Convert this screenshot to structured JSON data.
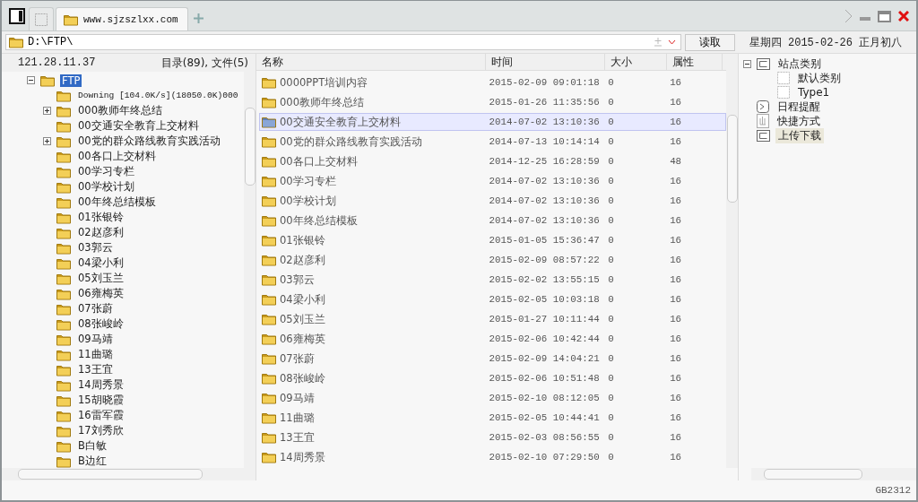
{
  "tabs": [
    {
      "label": "www.sjzszlxx.com",
      "selected": true
    }
  ],
  "address": {
    "value": "D:\\FTP\\",
    "read_button": "读取"
  },
  "date": "星期四 2015-02-26 正月初八",
  "left_header": {
    "ip": "121.28.11.37",
    "counts": "目录(89), 文件(5)"
  },
  "folder_tree": [
    {
      "label": "FTP",
      "selected": true,
      "expanded": true,
      "children": [
        {
          "label": "Downing [104.0K/s](18050.0K)000",
          "kind": "status"
        },
        {
          "label": "000教师年终总结",
          "kind": "folder",
          "expanded": false
        },
        {
          "label": "00交通安全教育上交材料",
          "kind": "folder"
        },
        {
          "label": "00党的群众路线教育实践活动",
          "kind": "folder",
          "expanded": false
        },
        {
          "label": "00各口上交材料",
          "kind": "folder"
        },
        {
          "label": "00学习专栏",
          "kind": "folder"
        },
        {
          "label": "00学校计划",
          "kind": "folder"
        },
        {
          "label": "00年终总结模板",
          "kind": "folder"
        },
        {
          "label": "01张银铃",
          "kind": "folder"
        },
        {
          "label": "02赵彦利",
          "kind": "folder"
        },
        {
          "label": "03郭云",
          "kind": "folder"
        },
        {
          "label": "04梁小利",
          "kind": "folder"
        },
        {
          "label": "05刘玉兰",
          "kind": "folder"
        },
        {
          "label": "06雍梅英",
          "kind": "folder"
        },
        {
          "label": "07张蔚",
          "kind": "folder"
        },
        {
          "label": "08张峻岭",
          "kind": "folder"
        },
        {
          "label": "09马靖",
          "kind": "folder"
        },
        {
          "label": "11曲璐",
          "kind": "folder"
        },
        {
          "label": "13王宜",
          "kind": "folder"
        },
        {
          "label": "14周秀景",
          "kind": "folder"
        },
        {
          "label": "15胡晓霞",
          "kind": "folder"
        },
        {
          "label": "16雷军霞",
          "kind": "folder"
        },
        {
          "label": "17刘秀欣",
          "kind": "folder"
        },
        {
          "label": "B白敏",
          "kind": "folder"
        },
        {
          "label": "B边红",
          "kind": "folder"
        }
      ]
    }
  ],
  "table": {
    "columns": [
      "名称",
      "时间",
      "大小",
      "属性"
    ],
    "rows": [
      {
        "name": "0000PPT培训内容",
        "time": "2015-02-09 09:01:18",
        "size": "0",
        "attr": "16",
        "selected": false
      },
      {
        "name": "000教师年终总结",
        "time": "2015-01-26 11:35:56",
        "size": "0",
        "attr": "16",
        "selected": false
      },
      {
        "name": "00交通安全教育上交材料",
        "time": "2014-07-02 13:10:36",
        "size": "0",
        "attr": "16",
        "selected": true
      },
      {
        "name": "00党的群众路线教育实践活动",
        "time": "2014-07-13 10:14:14",
        "size": "0",
        "attr": "16",
        "selected": false
      },
      {
        "name": "00各口上交材料",
        "time": "2014-12-25 16:28:59",
        "size": "0",
        "attr": "48",
        "selected": false
      },
      {
        "name": "00学习专栏",
        "time": "2014-07-02 13:10:36",
        "size": "0",
        "attr": "16",
        "selected": false
      },
      {
        "name": "00学校计划",
        "time": "2014-07-02 13:10:36",
        "size": "0",
        "attr": "16",
        "selected": false
      },
      {
        "name": "00年终总结模板",
        "time": "2014-07-02 13:10:36",
        "size": "0",
        "attr": "16",
        "selected": false
      },
      {
        "name": "01张银铃",
        "time": "2015-01-05 15:36:47",
        "size": "0",
        "attr": "16",
        "selected": false
      },
      {
        "name": "02赵彦利",
        "time": "2015-02-09 08:57:22",
        "size": "0",
        "attr": "16",
        "selected": false
      },
      {
        "name": "03郭云",
        "time": "2015-02-02 13:55:15",
        "size": "0",
        "attr": "16",
        "selected": false
      },
      {
        "name": "04梁小利",
        "time": "2015-02-05 10:03:18",
        "size": "0",
        "attr": "16",
        "selected": false
      },
      {
        "name": "05刘玉兰",
        "time": "2015-01-27 10:11:44",
        "size": "0",
        "attr": "16",
        "selected": false
      },
      {
        "name": "06雍梅英",
        "time": "2015-02-06 10:42:44",
        "size": "0",
        "attr": "16",
        "selected": false
      },
      {
        "name": "07张蔚",
        "time": "2015-02-09 14:04:21",
        "size": "0",
        "attr": "16",
        "selected": false
      },
      {
        "name": "08张峻岭",
        "time": "2015-02-06 10:51:48",
        "size": "0",
        "attr": "16",
        "selected": false
      },
      {
        "name": "09马靖",
        "time": "2015-02-10 08:12:05",
        "size": "0",
        "attr": "16",
        "selected": false
      },
      {
        "name": "11曲璐",
        "time": "2015-02-05 10:44:41",
        "size": "0",
        "attr": "16",
        "selected": false
      },
      {
        "name": "13王宜",
        "time": "2015-02-03 08:56:55",
        "size": "0",
        "attr": "16",
        "selected": false
      },
      {
        "name": "14周秀景",
        "time": "2015-02-10 07:29:50",
        "size": "0",
        "attr": "16",
        "selected": false
      }
    ]
  },
  "side_tree": [
    {
      "label": "站点类别",
      "kind": "category",
      "expanded": true,
      "selected": false,
      "children": [
        {
          "label": "默认类别",
          "kind": "sub"
        },
        {
          "label": "Type1",
          "kind": "sub"
        }
      ]
    },
    {
      "label": "日程提醒",
      "kind": "clock",
      "selected": false
    },
    {
      "label": "快捷方式",
      "kind": "hand",
      "selected": false
    },
    {
      "label": "上传下载",
      "kind": "category",
      "selected": true
    }
  ],
  "status_bar": {
    "encoding": "GB2312"
  }
}
